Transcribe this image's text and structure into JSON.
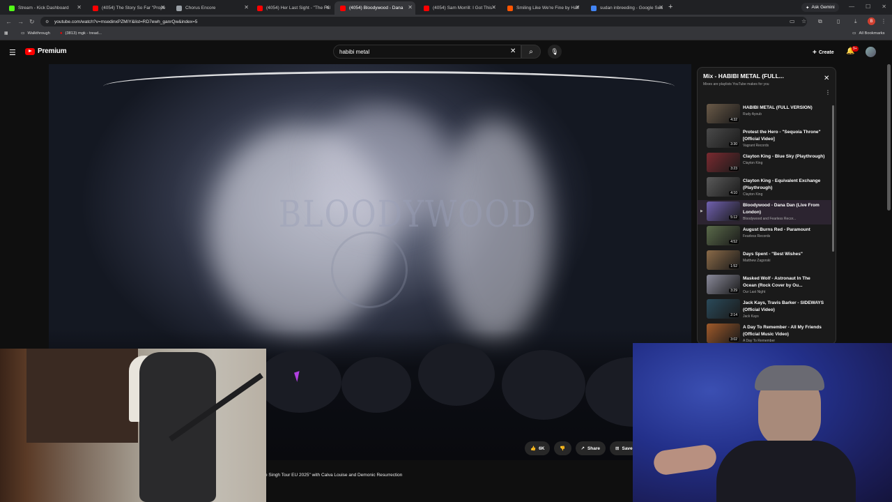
{
  "browser": {
    "tabs": [
      {
        "title": "Stream - Kick Dashboard",
        "favicon_color": "#53fc18",
        "active": false
      },
      {
        "title": "(4054) The Story So Far \"Prope",
        "favicon_color": "#ff0000",
        "active": false
      },
      {
        "title": "Chorus Encore",
        "favicon_color": "#9aa0a6",
        "active": false
      },
      {
        "title": "(4054) Her Last Sight - \"The Fal",
        "favicon_color": "#ff0000",
        "active": false
      },
      {
        "title": "(4054) Bloodywood - Dana",
        "favicon_color": "#ff0000",
        "active": true
      },
      {
        "title": "(4054) Sam Morrill: I Got This -",
        "favicon_color": "#ff0000",
        "active": false
      },
      {
        "title": "Smiling Like We're Fine by Half",
        "favicon_color": "#ff5500",
        "active": false
      },
      {
        "title": "sudan inbreeding - Google Sea",
        "favicon_color": "#4285f4",
        "active": false
      }
    ],
    "new_tab": "+",
    "ask_gemini": "Ask Gemini",
    "url": "youtube.com/watch?v=msedinxPZMIY&list=RD7ewh_ganrQw&index=5",
    "profile_initial": "B",
    "bookmarks": [
      {
        "label": "Walkthrough",
        "icon": "folder-icon"
      },
      {
        "label": "(3813) mgk - tread...",
        "icon": "youtube-icon"
      }
    ],
    "all_bookmarks": "All Bookmarks"
  },
  "youtube": {
    "logo_text": "Premium",
    "search_value": "habibi metal",
    "create_label": "Create",
    "notification_badge": "9+",
    "video": {
      "description_line": "e Singh Tour EU 2025\" with Calva Louise and Demonic Resurrection",
      "like_count": "6K",
      "share_label": "Share",
      "save_label": "Save",
      "stage_band_text": "BLOODYWOOD"
    },
    "playlist": {
      "title": "Mix - HABIBI METAL (FULL...",
      "subtitle": "Mixes are playlists YouTube makes for you",
      "items": [
        {
          "title": "HABIBI METAL (FULL VERSION)",
          "channel": "Rudy Ayoub",
          "duration": "4:32",
          "thumb": "#6a5a48"
        },
        {
          "title": "Protest the Hero - \"Sequoia Throne\" [Official Video]",
          "channel": "Vagrant Records",
          "duration": "3:30",
          "thumb": "#4a4a4a"
        },
        {
          "title": "Clayton King - Blue Sky (Playthrough)",
          "channel": "Clayton King",
          "duration": "3:23",
          "thumb": "#7a2a30"
        },
        {
          "title": "Clayton King - Equivalent Exchange (Playthrough)",
          "channel": "Clayton King",
          "duration": "4:10",
          "thumb": "#5a5a5a"
        },
        {
          "title": "Bloodywood - Dana Dan (Live From London)",
          "channel": "Bloodywood and Fearless Recor...",
          "duration": "5:12",
          "thumb": "#7060b0",
          "current": true
        },
        {
          "title": "August Burns Red - Paramount",
          "channel": "Fearless Records",
          "duration": "4:52",
          "thumb": "#5a6a4a"
        },
        {
          "title": "Days Spent - \"Best Wishes\"",
          "channel": "Matthew Zagorski",
          "duration": "1:52",
          "thumb": "#8a6a48"
        },
        {
          "title": "Masked Wolf - Astronaut In The Ocean (Rock Cover by Ou...",
          "channel": "Our Last Night",
          "duration": "3:29",
          "thumb": "#8a8a9a"
        },
        {
          "title": "Jack Kays, Travis Barker - SIDEWAYS (Official Video)",
          "channel": "Jack Kays",
          "duration": "2:14",
          "thumb": "#2a4a5a"
        },
        {
          "title": "A Day To Remember - All My Friends (Official Music Video)",
          "channel": "A Day To Remember",
          "duration": "3:02",
          "thumb": "#a05a2a"
        }
      ]
    }
  },
  "overlays": {
    "webcam_left": "webcam-room",
    "webcam_right": "webcam-streamer"
  }
}
